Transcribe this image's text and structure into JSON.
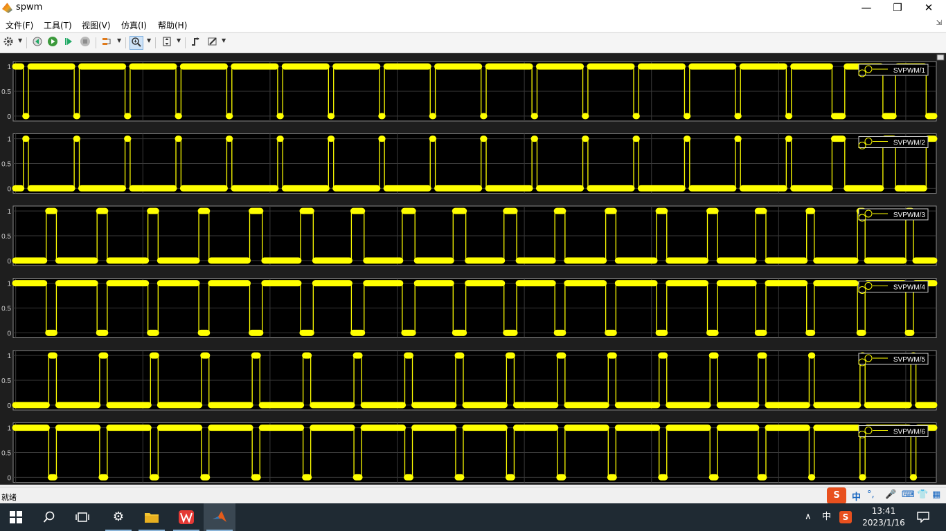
{
  "window": {
    "title": "spwm",
    "min_glyph": "—",
    "max_glyph": "❐",
    "close_glyph": "✕"
  },
  "menu": {
    "items": [
      "文件(F)",
      "工具(T)",
      "视图(V)",
      "仿真(I)",
      "帮助(H)"
    ],
    "pin_glyph": "⇲"
  },
  "toolbar": {
    "icons": [
      "gear-icon",
      "step-back-icon",
      "run-icon",
      "step-forward-icon",
      "stop-icon",
      "signal-select-icon",
      "zoom-icon",
      "autoscale-icon",
      "trigger-icon",
      "style-icon"
    ]
  },
  "status": {
    "text": "就绪"
  },
  "ime": {
    "brand": "S",
    "lang": "中",
    "punct": "°,"
  },
  "taskbar": {
    "tray_lang": "中",
    "time": "13:41",
    "date": "2023/1/16"
  },
  "chart_data": {
    "type": "line",
    "x_ticks": [
      "0.406",
      "0.4065",
      "0.407",
      "0.4075",
      "0.408",
      "0.4085",
      "0.409",
      "0.4095"
    ],
    "xlim": [
      0.40599,
      0.40962
    ],
    "y_ticks": [
      "0",
      "0.5",
      "1"
    ],
    "ylim": [
      -0.1,
      1.1
    ],
    "colors": {
      "trace": "#ffff00",
      "background": "#000000",
      "figure": "#1e1e1e",
      "axes": "#8a8a8a"
    },
    "series": [
      {
        "name": "SVPWM/1",
        "start": 1,
        "transitions": [
          0.40603,
          0.40605,
          0.40623,
          0.40625,
          0.40643,
          0.40645,
          0.40663,
          0.40665,
          0.40683,
          0.40685,
          0.40703,
          0.40705,
          0.40723,
          0.40725,
          0.40743,
          0.40745,
          0.40763,
          0.40765,
          0.40783,
          0.40785,
          0.40803,
          0.40805,
          0.40823,
          0.40825,
          0.40843,
          0.40845,
          0.40863,
          0.40865,
          0.40883,
          0.40885,
          0.40903,
          0.40905,
          0.40921,
          0.40926,
          0.40941,
          0.40946,
          0.40958
        ]
      },
      {
        "name": "SVPWM/2",
        "start": 0,
        "transitions": [
          0.40603,
          0.40605,
          0.40623,
          0.40625,
          0.40643,
          0.40645,
          0.40663,
          0.40665,
          0.40683,
          0.40685,
          0.40703,
          0.40705,
          0.40723,
          0.40725,
          0.40743,
          0.40745,
          0.40763,
          0.40765,
          0.40783,
          0.40785,
          0.40803,
          0.40805,
          0.40823,
          0.40825,
          0.40843,
          0.40845,
          0.40863,
          0.40865,
          0.40883,
          0.40885,
          0.40903,
          0.40905,
          0.40921,
          0.40926,
          0.40941,
          0.40946,
          0.40958
        ]
      },
      {
        "name": "SVPWM/3",
        "start": 0,
        "transitions": [
          0.40612,
          0.40616,
          0.40632,
          0.40636,
          0.40652,
          0.40656,
          0.40672,
          0.40676,
          0.40692,
          0.40697,
          0.40712,
          0.40717,
          0.40732,
          0.40737,
          0.40752,
          0.40757,
          0.40772,
          0.40777,
          0.40792,
          0.40797,
          0.40812,
          0.40816,
          0.40832,
          0.40836,
          0.40852,
          0.40856,
          0.40872,
          0.40876,
          0.40891,
          0.40895,
          0.40911,
          0.40914,
          0.40931,
          0.40934,
          0.4095,
          0.40953
        ]
      },
      {
        "name": "SVPWM/4",
        "start": 1,
        "transitions": [
          0.40612,
          0.40616,
          0.40632,
          0.40636,
          0.40652,
          0.40656,
          0.40672,
          0.40676,
          0.40692,
          0.40697,
          0.40712,
          0.40717,
          0.40732,
          0.40737,
          0.40752,
          0.40757,
          0.40772,
          0.40777,
          0.40792,
          0.40797,
          0.40812,
          0.40816,
          0.40832,
          0.40836,
          0.40852,
          0.40856,
          0.40872,
          0.40876,
          0.40891,
          0.40895,
          0.40911,
          0.40914,
          0.40931,
          0.40934,
          0.4095,
          0.40953
        ]
      },
      {
        "name": "SVPWM/5",
        "start": 0,
        "transitions": [
          0.40613,
          0.40616,
          0.40633,
          0.40636,
          0.40653,
          0.40656,
          0.40673,
          0.40676,
          0.40693,
          0.40696,
          0.40713,
          0.40716,
          0.40733,
          0.40736,
          0.40753,
          0.40756,
          0.40773,
          0.40776,
          0.40793,
          0.40796,
          0.40813,
          0.40816,
          0.40833,
          0.40836,
          0.40853,
          0.40856,
          0.40873,
          0.40876,
          0.40892,
          0.40895,
          0.40912,
          0.40914,
          0.40932,
          0.40934,
          0.40952,
          0.40954
        ]
      },
      {
        "name": "SVPWM/6",
        "start": 1,
        "transitions": [
          0.40613,
          0.40616,
          0.40633,
          0.40636,
          0.40653,
          0.40656,
          0.40673,
          0.40676,
          0.40693,
          0.40696,
          0.40713,
          0.40716,
          0.40733,
          0.40736,
          0.40753,
          0.40756,
          0.40773,
          0.40776,
          0.40793,
          0.40796,
          0.40813,
          0.40816,
          0.40833,
          0.40836,
          0.40853,
          0.40856,
          0.40873,
          0.40876,
          0.40892,
          0.40895,
          0.40912,
          0.40914,
          0.40932,
          0.40934,
          0.40952,
          0.40954
        ]
      }
    ]
  }
}
